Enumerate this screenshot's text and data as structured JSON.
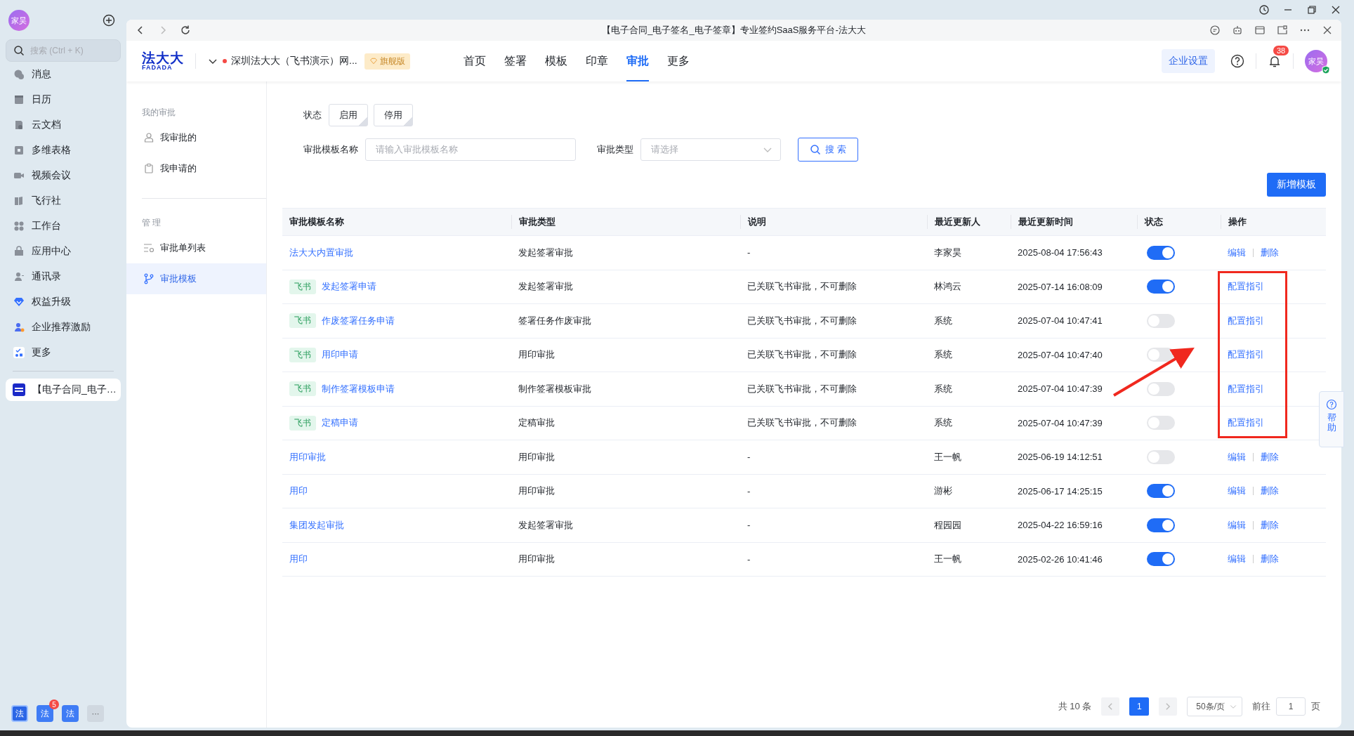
{
  "sidebar": {
    "avatar": "家昊",
    "search": {
      "placeholder": "搜索 (Ctrl + K)"
    },
    "items": [
      {
        "label": "消息"
      },
      {
        "label": "日历"
      },
      {
        "label": "云文档"
      },
      {
        "label": "多维表格"
      },
      {
        "label": "视频会议"
      },
      {
        "label": "飞行社"
      },
      {
        "label": "工作台"
      },
      {
        "label": "应用中心"
      },
      {
        "label": "通讯录"
      },
      {
        "label": "权益升级"
      },
      {
        "label": "企业推荐激励"
      },
      {
        "label": "更多"
      }
    ],
    "open_app": {
      "label": "【电子合同_电子…"
    },
    "dock": [
      {
        "label": "法",
        "selected": true
      },
      {
        "label": "法",
        "selected": false,
        "badge": "5"
      },
      {
        "label": "法",
        "selected": false
      },
      {
        "label": "···",
        "selected": false
      }
    ]
  },
  "browser": {
    "title": "【电子合同_电子签名_电子签章】专业签约SaaS服务平台-法大大"
  },
  "header": {
    "logo": "法大大",
    "logo_sub": "FADADA",
    "company": "深圳法大大（飞书演示）网...",
    "edition": "旗舰版",
    "nav": [
      {
        "label": "首页",
        "selected": false
      },
      {
        "label": "签署",
        "selected": false
      },
      {
        "label": "模板",
        "selected": false
      },
      {
        "label": "印章",
        "selected": false
      },
      {
        "label": "审批",
        "selected": true
      },
      {
        "label": "更多",
        "selected": false
      }
    ],
    "settings": "企业设置",
    "notifications": "38",
    "avatar": "家昊"
  },
  "side_nav": [
    {
      "title": "我的审批",
      "items": [
        {
          "label": "我审批的",
          "selected": false
        },
        {
          "label": "我申请的",
          "selected": false
        }
      ]
    },
    {
      "title": "管 理",
      "items": [
        {
          "label": "审批单列表",
          "selected": false
        },
        {
          "label": "审批模板",
          "selected": true
        }
      ]
    }
  ],
  "filters": {
    "status_label": "状态",
    "status_options": [
      "启用",
      "停用"
    ],
    "name_label": "审批模板名称",
    "name_placeholder": "请输入审批模板名称",
    "type_label": "审批类型",
    "type_placeholder": "请选择",
    "search": "搜 索"
  },
  "add_button": "新增模板",
  "table": {
    "columns": [
      "审批模板名称",
      "审批类型",
      "说明",
      "最近更新人",
      "最近更新时间",
      "状态",
      "操作"
    ],
    "rows": [
      {
        "name": "法大大内置审批",
        "type": "发起签署审批",
        "note": "-",
        "updater": "李家昊",
        "time": "2025-08-04 17:56:43",
        "on": true,
        "actions": [
          "编辑",
          "删除"
        ]
      },
      {
        "tag": "飞书",
        "name": "发起签署申请",
        "type": "发起签署审批",
        "note": "已关联飞书审批，不可删除",
        "updater": "林鸿云",
        "time": "2025-07-14 16:08:09",
        "on": true,
        "actions": [
          "配置指引"
        ]
      },
      {
        "tag": "飞书",
        "name": "作废签署任务申请",
        "type": "签署任务作废审批",
        "note": "已关联飞书审批，不可删除",
        "updater": "系统",
        "time": "2025-07-04 10:47:41",
        "on": false,
        "actions": [
          "配置指引"
        ]
      },
      {
        "tag": "飞书",
        "name": "用印申请",
        "type": "用印审批",
        "note": "已关联飞书审批，不可删除",
        "updater": "系统",
        "time": "2025-07-04 10:47:40",
        "on": false,
        "actions": [
          "配置指引"
        ]
      },
      {
        "tag": "飞书",
        "name": "制作签署模板申请",
        "type": "制作签署模板审批",
        "note": "已关联飞书审批，不可删除",
        "updater": "系统",
        "time": "2025-07-04 10:47:39",
        "on": false,
        "actions": [
          "配置指引"
        ]
      },
      {
        "tag": "飞书",
        "name": "定稿申请",
        "type": "定稿审批",
        "note": "已关联飞书审批，不可删除",
        "updater": "系统",
        "time": "2025-07-04 10:47:39",
        "on": false,
        "actions": [
          "配置指引"
        ]
      },
      {
        "name": "用印审批",
        "type": "用印审批",
        "note": "-",
        "updater": "王一帆",
        "time": "2025-06-19 14:12:51",
        "on": false,
        "actions": [
          "编辑",
          "删除"
        ]
      },
      {
        "name": "用印",
        "type": "用印审批",
        "note": "-",
        "updater": "游彬",
        "time": "2025-06-17 14:25:15",
        "on": true,
        "actions": [
          "编辑",
          "删除"
        ]
      },
      {
        "name": "集团发起审批",
        "type": "发起签署审批",
        "note": "-",
        "updater": "程园园",
        "time": "2025-04-22 16:59:16",
        "on": true,
        "actions": [
          "编辑",
          "删除"
        ]
      },
      {
        "name": "用印",
        "type": "用印审批",
        "note": "-",
        "updater": "王一帆",
        "time": "2025-02-26 10:41:46",
        "on": true,
        "actions": [
          "编辑",
          "删除"
        ]
      }
    ]
  },
  "pagination": {
    "total": "共 10 条",
    "pages": [
      {
        "label": "1",
        "selected": true
      }
    ],
    "page_size": "50条/页",
    "goto_label": "前往",
    "goto_value": "1",
    "goto_unit": "页"
  },
  "help": "帮助"
}
